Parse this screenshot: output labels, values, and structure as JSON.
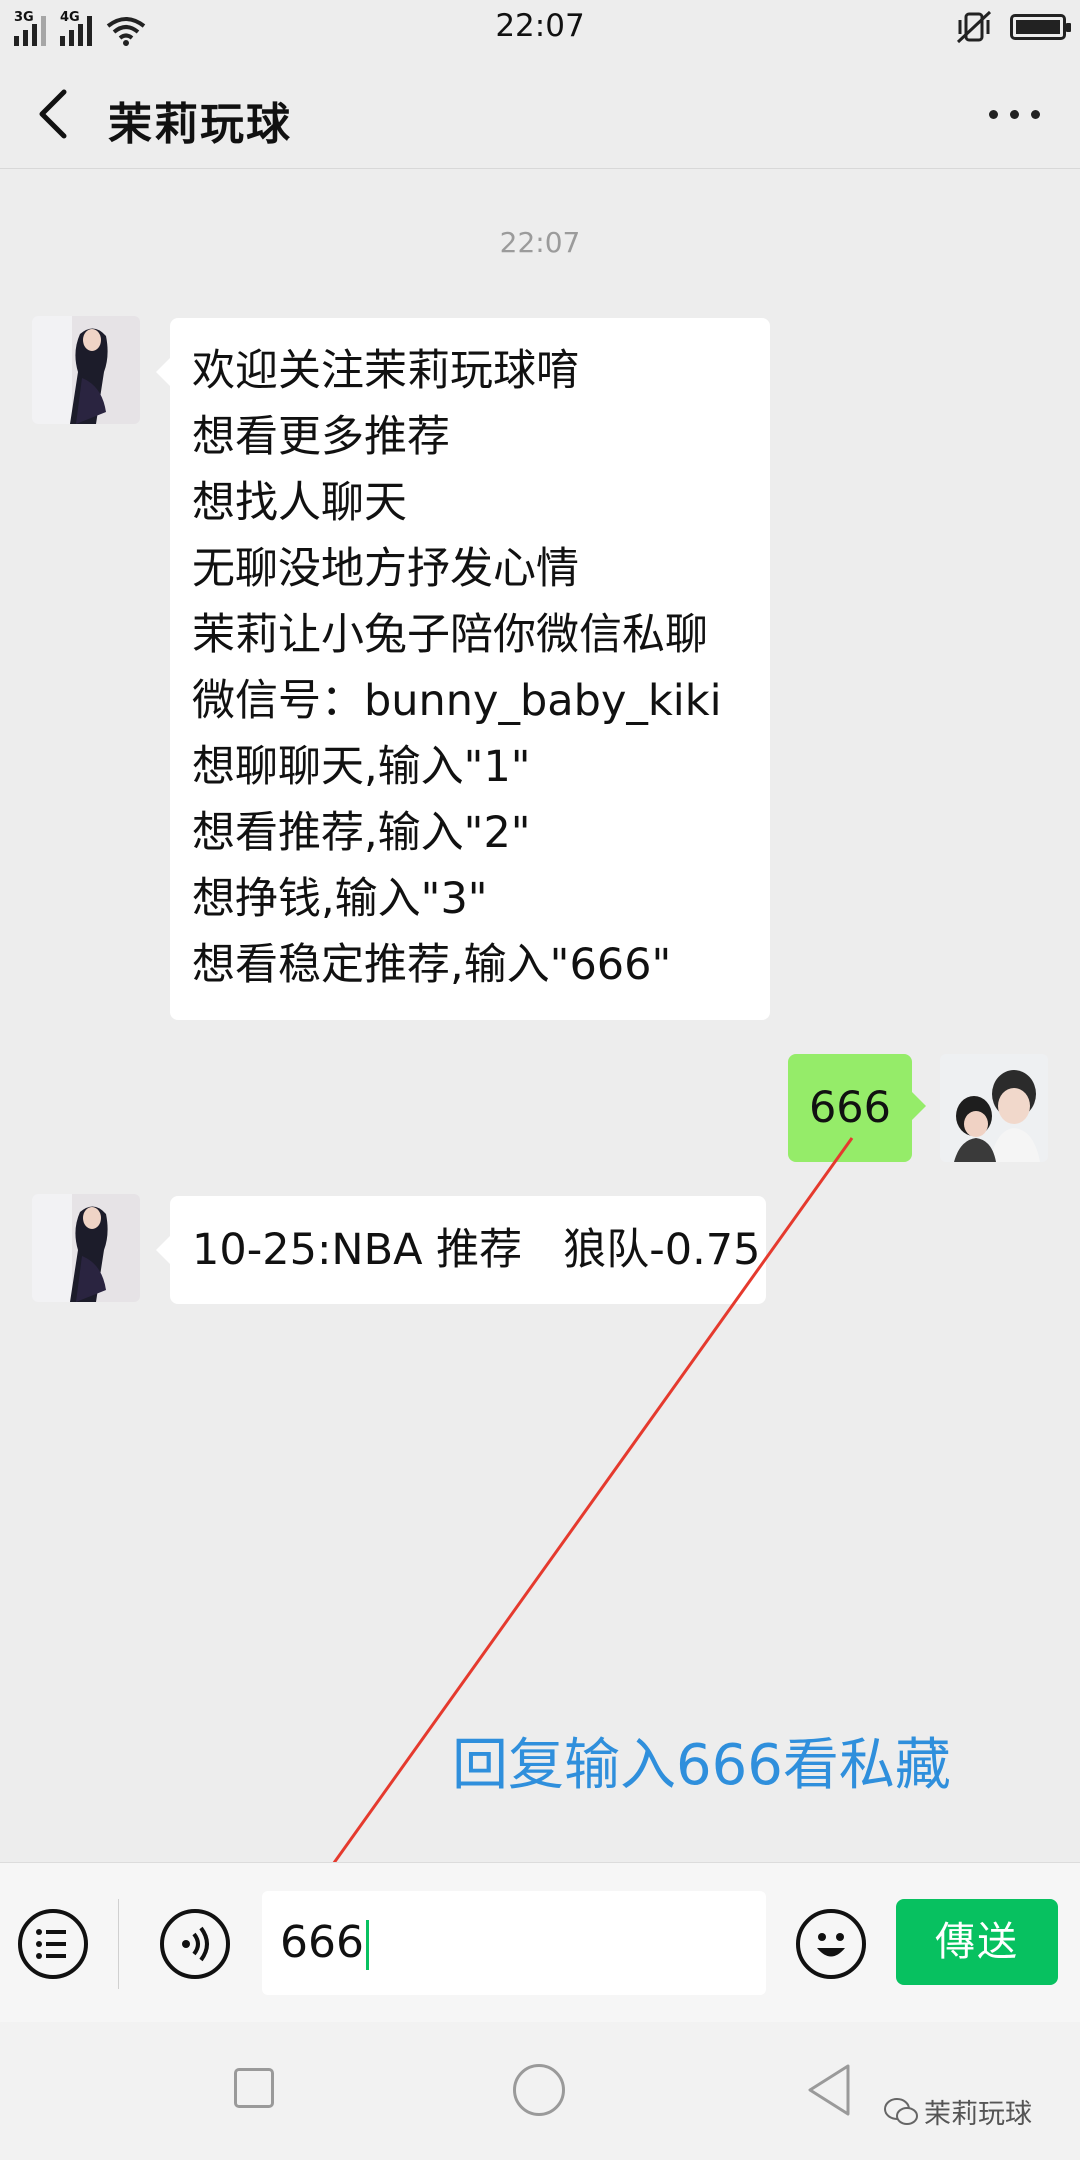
{
  "status_bar": {
    "time": "22:07",
    "sim1": "3G",
    "sim2": "4G"
  },
  "header": {
    "title": "茉莉玩球"
  },
  "chat": {
    "timestamp": "22:07",
    "messages": [
      {
        "side": "left",
        "lines": [
          "欢迎关注茉莉玩球唷",
          "想看更多推荐",
          "想找人聊天",
          "无聊没地方抒发心情",
          "茉莉让小兔子陪你微信私聊",
          "微信号：bunny_baby_kiki",
          "想聊聊天,输入\"1\"",
          "想看推荐,输入\"2\"",
          "想挣钱,输入\"3\"",
          "想看稳定推荐,输入\"666\""
        ]
      },
      {
        "side": "right",
        "text": "666"
      },
      {
        "side": "left",
        "text": "10-25:NBA 推荐   狼队-0.75"
      }
    ]
  },
  "annotation": {
    "text": "回复输入666看私藏",
    "color": "#2f8fdc",
    "arrow_color": "#e53a2e"
  },
  "input_bar": {
    "value": "666",
    "send_label": "傳送"
  },
  "watermark": {
    "text": "茉莉玩球"
  },
  "colors": {
    "background": "#ededed",
    "outgoing_bubble": "#95ec69",
    "send_button": "#07c160"
  }
}
